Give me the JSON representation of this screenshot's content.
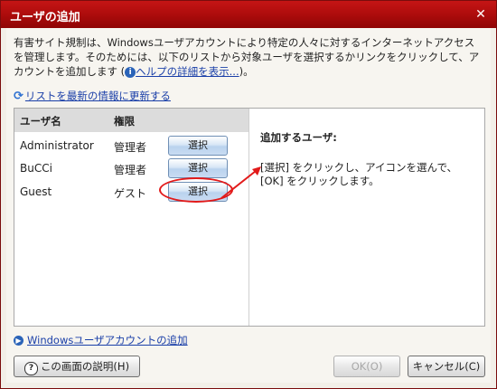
{
  "window": {
    "title": "ユーザの追加",
    "close_glyph": "✕"
  },
  "description": {
    "text": "有害サイト規制は、Windowsユーザアカウントにより特定の人々に対するインターネットアクセスを管理します。そのためには、以下のリストから対象ユーザを選択するかリンクをクリックして、アカウントを追加します (",
    "help_icon": "i",
    "help_link": "ヘルプの詳細を表示...",
    "tail": ")。"
  },
  "refresh": {
    "icon": "refresh-icon",
    "label": "リストを最新の情報に更新する"
  },
  "user_list": {
    "columns": [
      "ユーザ名",
      "権限"
    ],
    "rows": [
      {
        "name": "Administrator",
        "role": "管理者",
        "button": "選択"
      },
      {
        "name": "BuCCi",
        "role": "管理者",
        "button": "選択"
      },
      {
        "name": "Guest",
        "role": "ゲスト",
        "button": "選択"
      }
    ]
  },
  "info": {
    "title": "追加するユーザ:",
    "text": "[選択] をクリックし、アイコンを選んで、[OK] をクリックします。"
  },
  "add_account_link": "Windowsユーザアカウントの追加",
  "buttons": {
    "help": "この画面の説明(H)",
    "ok": "OK(O)",
    "cancel": "キャンセル(C)"
  },
  "colors": {
    "titlebar": "#b00d0d",
    "annotation": "#e21a1a",
    "link": "#1a3fa8"
  }
}
